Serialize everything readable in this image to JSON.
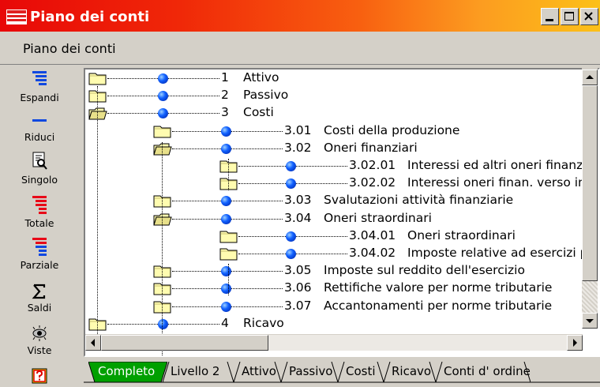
{
  "window": {
    "title": "Piano dei conti"
  },
  "menu": {
    "item": "Piano dei conti"
  },
  "toolbar": [
    {
      "label": "Espandi",
      "icon": "expand-icon"
    },
    {
      "label": "Riduci",
      "icon": "collapse-icon"
    },
    {
      "label": "Singolo",
      "icon": "single-icon"
    },
    {
      "label": "Totale",
      "icon": "total-icon"
    },
    {
      "label": "Parziale",
      "icon": "partial-icon"
    },
    {
      "label": "Saldi",
      "icon": "sigma-icon"
    },
    {
      "label": "Viste",
      "icon": "views-icon"
    }
  ],
  "tree": [
    {
      "code": "1",
      "name": "Attivo"
    },
    {
      "code": "2",
      "name": "Passivo"
    },
    {
      "code": "3",
      "name": "Costi"
    },
    {
      "code": "3.01",
      "name": "Costi della produzione"
    },
    {
      "code": "3.02",
      "name": "Oneri finanziari"
    },
    {
      "code": "3.02.01",
      "name": "Interessi ed altri oneri finanzia"
    },
    {
      "code": "3.02.02",
      "name": "Interessi oneri finan. verso imp"
    },
    {
      "code": "3.03",
      "name": "Svalutazioni attività finanziarie"
    },
    {
      "code": "3.04",
      "name": "Oneri straordinari"
    },
    {
      "code": "3.04.01",
      "name": "Oneri straordinari"
    },
    {
      "code": "3.04.02",
      "name": "Imposte relative ad esercizi pr"
    },
    {
      "code": "3.05",
      "name": "Imposte sul reddito dell'esercizio"
    },
    {
      "code": "3.06",
      "name": "Rettifiche valore per norme tributarie"
    },
    {
      "code": "3.07",
      "name": "Accantonamenti per norme tributarie"
    },
    {
      "code": "4",
      "name": "Ricavo"
    }
  ],
  "tabs": [
    {
      "label": "Completo",
      "active": true
    },
    {
      "label": "Livello 2"
    },
    {
      "label": "Attivo"
    },
    {
      "label": "Passivo"
    },
    {
      "label": "Costi"
    },
    {
      "label": "Ricavo"
    },
    {
      "label": "Conti d' ordine"
    }
  ],
  "colors": {
    "title_start": "#e80808",
    "title_end": "#fcc018",
    "active_tab": "#00a000"
  }
}
